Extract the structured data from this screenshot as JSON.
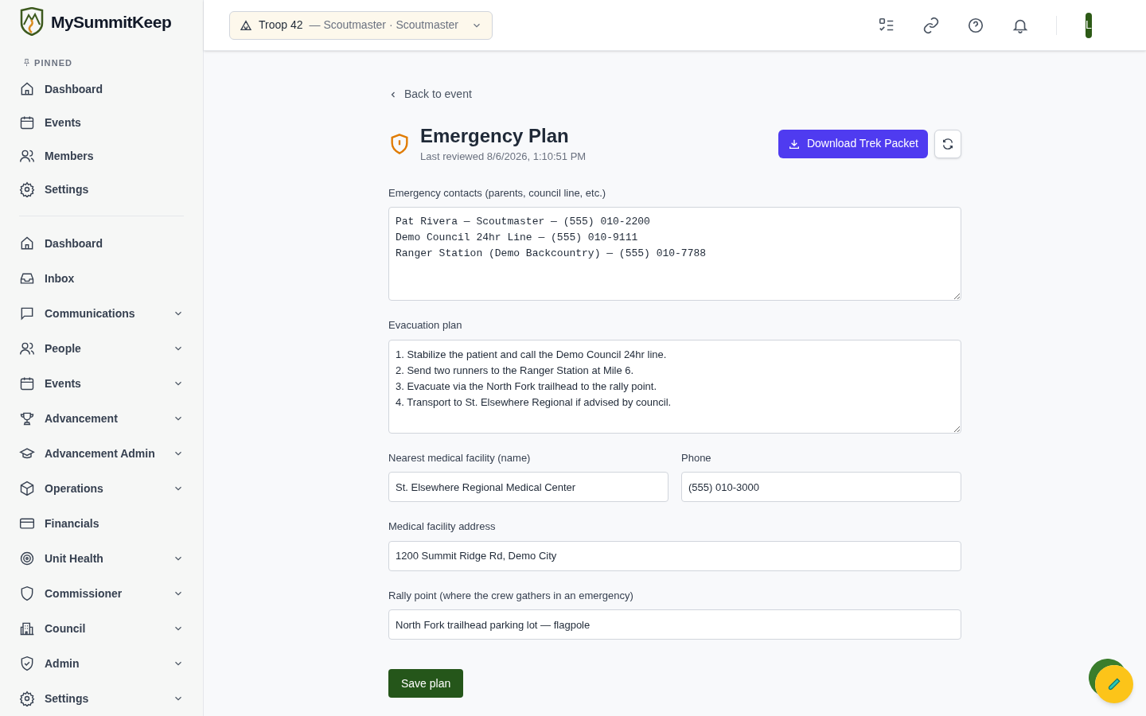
{
  "app": {
    "name": "MySummitKeep"
  },
  "sidebar": {
    "pinned_heading": "PINNED",
    "pinned": [
      {
        "label": "Dashboard"
      },
      {
        "label": "Events"
      },
      {
        "label": "Members"
      },
      {
        "label": "Settings"
      }
    ],
    "items": [
      {
        "label": "Dashboard",
        "expandable": false
      },
      {
        "label": "Inbox",
        "expandable": false
      },
      {
        "label": "Communications",
        "expandable": true
      },
      {
        "label": "People",
        "expandable": true
      },
      {
        "label": "Events",
        "expandable": true
      },
      {
        "label": "Advancement",
        "expandable": true
      },
      {
        "label": "Advancement Admin",
        "expandable": true
      },
      {
        "label": "Operations",
        "expandable": true
      },
      {
        "label": "Financials",
        "expandable": false
      },
      {
        "label": "Unit Health",
        "expandable": true
      },
      {
        "label": "Commissioner",
        "expandable": true
      },
      {
        "label": "Council",
        "expandable": true
      },
      {
        "label": "Admin",
        "expandable": true
      },
      {
        "label": "Settings",
        "expandable": true
      }
    ]
  },
  "header": {
    "unit_selector": {
      "unit": "Troop 42",
      "role": "— Scoutmaster · Scoutmaster"
    },
    "avatar": "L"
  },
  "page": {
    "back_link": "Back to event",
    "title": "Emergency Plan",
    "subtitle": "Last reviewed 8/6/2026, 1:10:51 PM",
    "download_button": "Download Trek Packet"
  },
  "form": {
    "rows": [
      [
        {
          "kind": "code-area",
          "label": "Emergency contacts (parents, council line, etc.)",
          "value": "Pat Rivera — Scoutmaster — (555) 010-2200\nDemo Council 24hr Line — (555) 010-9111\nRanger Station (Demo Backcountry) — (555) 010-7788"
        }
      ],
      [
        {
          "kind": "text-area",
          "label": "Evacuation plan",
          "value": "1. Stabilize the patient and call the Demo Council 24hr line.\n2. Send two runners to the Ranger Station at Mile 6.\n3. Evacuate via the North Fork trailhead to the rally point.\n4. Transport to St. Elsewhere Regional if advised by council."
        }
      ],
      [
        {
          "kind": "input",
          "label": "Nearest medical facility (name)",
          "value": "St. Elsewhere Regional Medical Center"
        },
        {
          "kind": "input",
          "label": "Phone",
          "value": "(555) 010-3000"
        }
      ],
      [
        {
          "kind": "input",
          "label": "Medical facility address",
          "value": "1200 Summit Ridge Rd, Demo City"
        }
      ],
      [
        {
          "kind": "input",
          "label": "Rally point (where the crew gathers in an emergency)",
          "value": "North Fork trailhead parking lot — flagpole"
        }
      ]
    ],
    "save_button": "Save plan"
  }
}
